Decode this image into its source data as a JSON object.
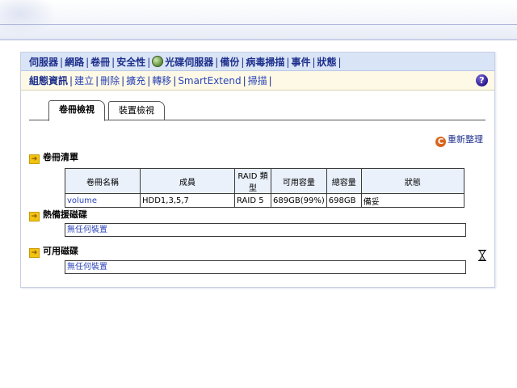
{
  "nav_primary": {
    "items": [
      {
        "label": "伺服器"
      },
      {
        "label": "網路"
      },
      {
        "label": "卷冊"
      },
      {
        "label": "安全性"
      },
      {
        "label": "光碟伺服器",
        "icon": "globe-icon"
      },
      {
        "label": "備份"
      },
      {
        "label": "病毒掃描"
      },
      {
        "label": "事件"
      },
      {
        "label": "狀態"
      }
    ]
  },
  "nav_secondary": {
    "items": [
      {
        "label": "組態資訊",
        "active": true
      },
      {
        "label": "建立"
      },
      {
        "label": "刪除"
      },
      {
        "label": "擴充"
      },
      {
        "label": "轉移"
      },
      {
        "label": "SmartExtend"
      },
      {
        "label": "掃描"
      }
    ],
    "help_label": "?"
  },
  "tabs": [
    {
      "label": "卷冊檢視",
      "active": true
    },
    {
      "label": "裝置檢視",
      "active": false
    }
  ],
  "refresh_label": "重新整理",
  "refresh_icon": "C",
  "sections": {
    "volume_list_title": "卷冊清單",
    "hot_spare_title": "熱備援磁碟",
    "available_title": "可用磁碟"
  },
  "volume_table": {
    "headers": [
      "卷冊名稱",
      "成員",
      "RAID 類型",
      "可用容量",
      "總容量",
      "狀態"
    ],
    "rows": [
      [
        "volume",
        "HDD1,3,5,7",
        "RAID 5",
        "689GB(99%)",
        "698GB",
        "備妥"
      ]
    ]
  },
  "hot_spare_value": "無任何裝置",
  "available_value": "無任何裝置",
  "colors": {
    "nav_bg": "#d9e4f6",
    "subnav_bg": "#fdf9e6",
    "link": "#2d45b8",
    "accent": "#1d2f8c"
  }
}
